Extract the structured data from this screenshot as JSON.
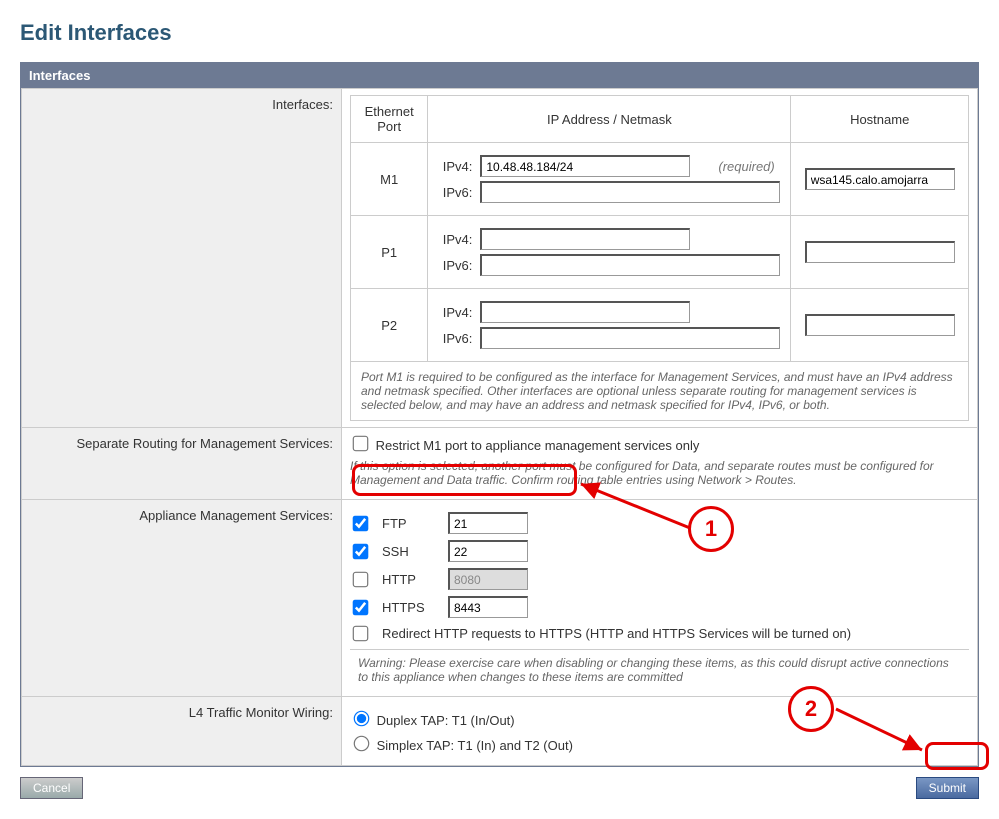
{
  "title": "Edit Interfaces",
  "panelHeader": "Interfaces",
  "rows": {
    "interfacesLabel": "Interfaces:",
    "sepRoutingLabel": "Separate Routing for Management Services:",
    "amsLabel": "Appliance Management Services:",
    "l4Label": "L4 Traffic Monitor Wiring:"
  },
  "portTable": {
    "col1": "Ethernet Port",
    "col2": "IP Address / Netmask",
    "col3": "Hostname",
    "ports": [
      {
        "name": "M1",
        "ipv4": "10.48.48.184/24",
        "ipv6": "",
        "required": "(required)",
        "hostname": "wsa145.calo.amojarra"
      },
      {
        "name": "P1",
        "ipv4": "",
        "ipv6": "",
        "required": "",
        "hostname": ""
      },
      {
        "name": "P2",
        "ipv4": "",
        "ipv6": "",
        "required": "",
        "hostname": ""
      }
    ],
    "ipv4lbl": "IPv4:",
    "ipv6lbl": "IPv6:",
    "note": "Port M1 is required to be configured as the interface for Management Services, and must have an IPv4 address and netmask specified. Other interfaces are optional unless separate routing for management services is selected below, and may have an address and netmask specified for IPv4, IPv6, or both."
  },
  "sepRouting": {
    "checkLabel": "Restrict M1 port to appliance management services only",
    "note": "If this option is selected, another port must be configured for Data, and separate routes must be configured for Management and Data traffic. Confirm routing table entries using Network > Routes."
  },
  "ams": {
    "ftp": {
      "label": "FTP",
      "checked": true,
      "port": "21",
      "disabled": false
    },
    "ssh": {
      "label": "SSH",
      "checked": true,
      "port": "22",
      "disabled": false
    },
    "http": {
      "label": "HTTP",
      "checked": false,
      "port": "8080",
      "disabled": true
    },
    "https": {
      "label": "HTTPS",
      "checked": true,
      "port": "8443",
      "disabled": false
    },
    "redirect": "Redirect HTTP requests to HTTPS (HTTP and HTTPS Services will be turned on)",
    "warning": "Warning: Please exercise care when disabling or changing these items, as this could disrupt active connections to this appliance when changes to these items are committed"
  },
  "l4": {
    "opt1": "Duplex TAP: T1 (In/Out)",
    "opt2": "Simplex TAP: T1 (In) and T2 (Out)"
  },
  "buttons": {
    "cancel": "Cancel",
    "submit": "Submit"
  },
  "annotations": {
    "n1": "1",
    "n2": "2"
  }
}
